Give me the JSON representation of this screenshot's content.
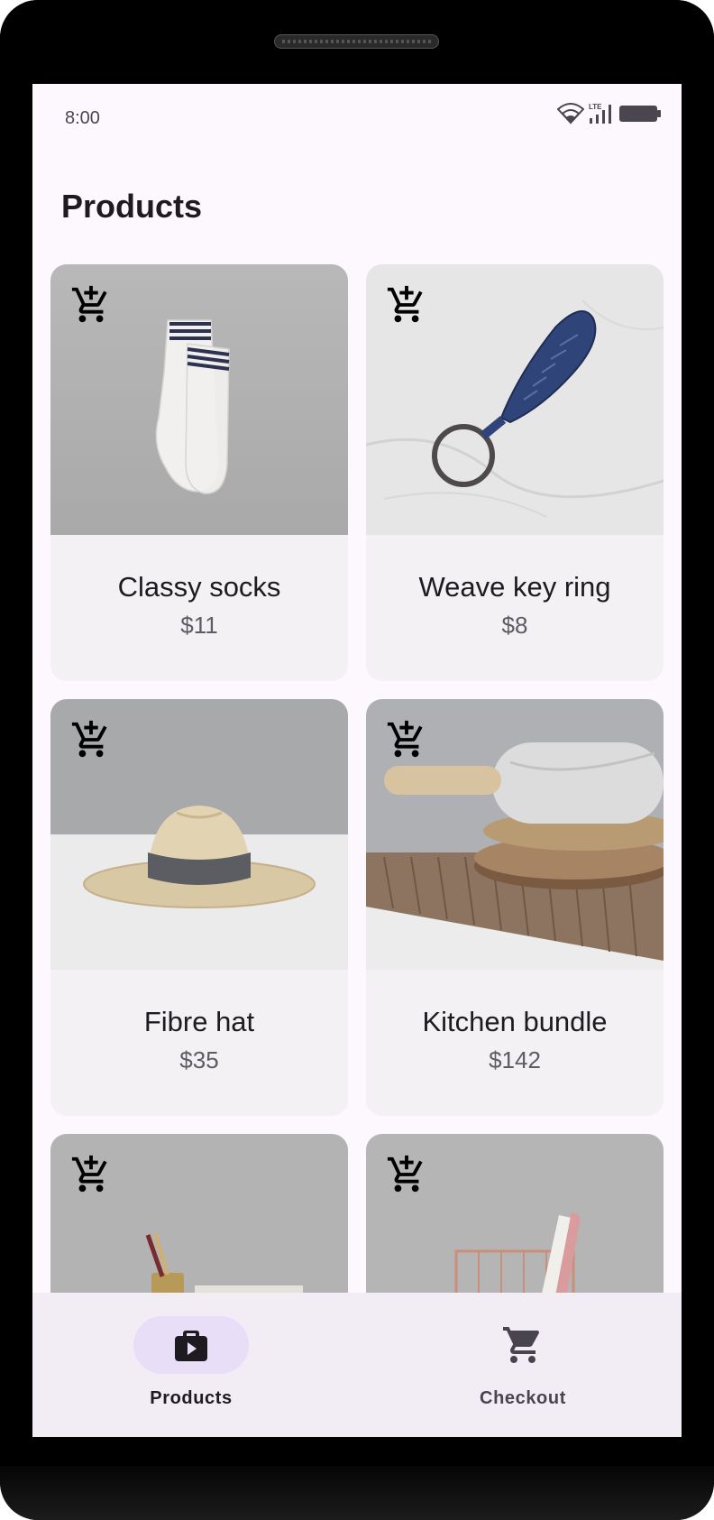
{
  "status_bar": {
    "time": "8:00",
    "network_label": "LTE",
    "icons": [
      "wifi-icon",
      "cell-signal-icon",
      "battery-icon"
    ]
  },
  "page": {
    "title": "Products"
  },
  "products": [
    {
      "name": "Classy socks",
      "price": "$11",
      "image": "socks",
      "action_icon": "add-shopping-cart-icon"
    },
    {
      "name": "Weave key ring",
      "price": "$8",
      "image": "key-ring",
      "action_icon": "add-shopping-cart-icon"
    },
    {
      "name": "Fibre hat",
      "price": "$35",
      "image": "hat",
      "action_icon": "add-shopping-cart-icon"
    },
    {
      "name": "Kitchen bundle",
      "price": "$142",
      "image": "kitchen-bundle",
      "action_icon": "add-shopping-cart-icon"
    },
    {
      "name": "",
      "price": "",
      "image": "desk-items",
      "action_icon": "add-shopping-cart-icon"
    },
    {
      "name": "",
      "price": "",
      "image": "wire-basket",
      "action_icon": "add-shopping-cart-icon"
    }
  ],
  "bottom_nav": {
    "items": [
      {
        "label": "Products",
        "icon": "work-bag-icon",
        "selected": true
      },
      {
        "label": "Checkout",
        "icon": "shopping-cart-icon",
        "selected": false
      }
    ]
  },
  "colors": {
    "background": "#fdf8fd",
    "card": "#f3f1f3",
    "nav_background": "#f2ecf4",
    "nav_selected_pill": "#e8def8",
    "text_primary": "#1d1b20",
    "text_secondary": "#5f5b64"
  }
}
